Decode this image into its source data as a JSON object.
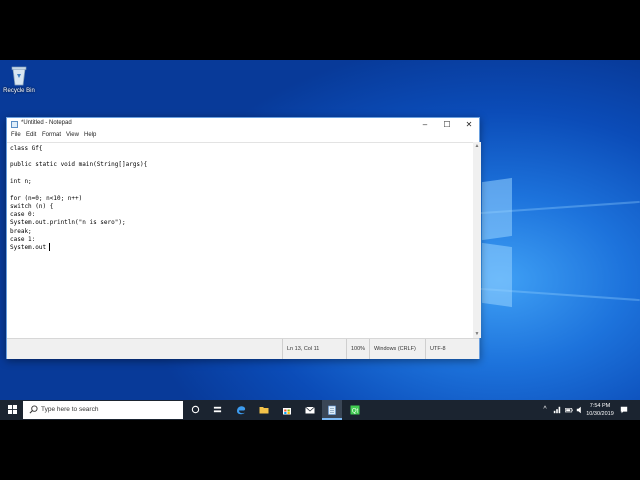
{
  "desktop": {
    "recycle_bin_label": "Recycle Bin"
  },
  "notepad": {
    "title": "*Untitled - Notepad",
    "menu": [
      "File",
      "Edit",
      "Format",
      "View",
      "Help"
    ],
    "lines": [
      "class Gf{",
      "",
      "public static void main(String[]args){",
      "",
      "int n;",
      "",
      "for (n=0; n<10; n++)",
      "switch (n) {",
      "case 0:",
      "System.out.println(\"n is sero\");",
      "break;",
      "case 1:",
      "System.out"
    ],
    "status": {
      "position": "Ln 13, Col 11",
      "zoom": "100%",
      "line_endings": "Windows (CRLF)",
      "encoding": "UTF-8"
    },
    "caption_buttons": {
      "minimize": "–",
      "maximize": "☐",
      "close": "✕"
    }
  },
  "taskbar": {
    "search_placeholder": "Type here to search",
    "pinned": [
      "task-view",
      "file-explorer",
      "edge",
      "folder",
      "store",
      "mail",
      "notepad",
      "qt-creator"
    ],
    "time": "7:54 PM",
    "date": "10/30/2019"
  }
}
